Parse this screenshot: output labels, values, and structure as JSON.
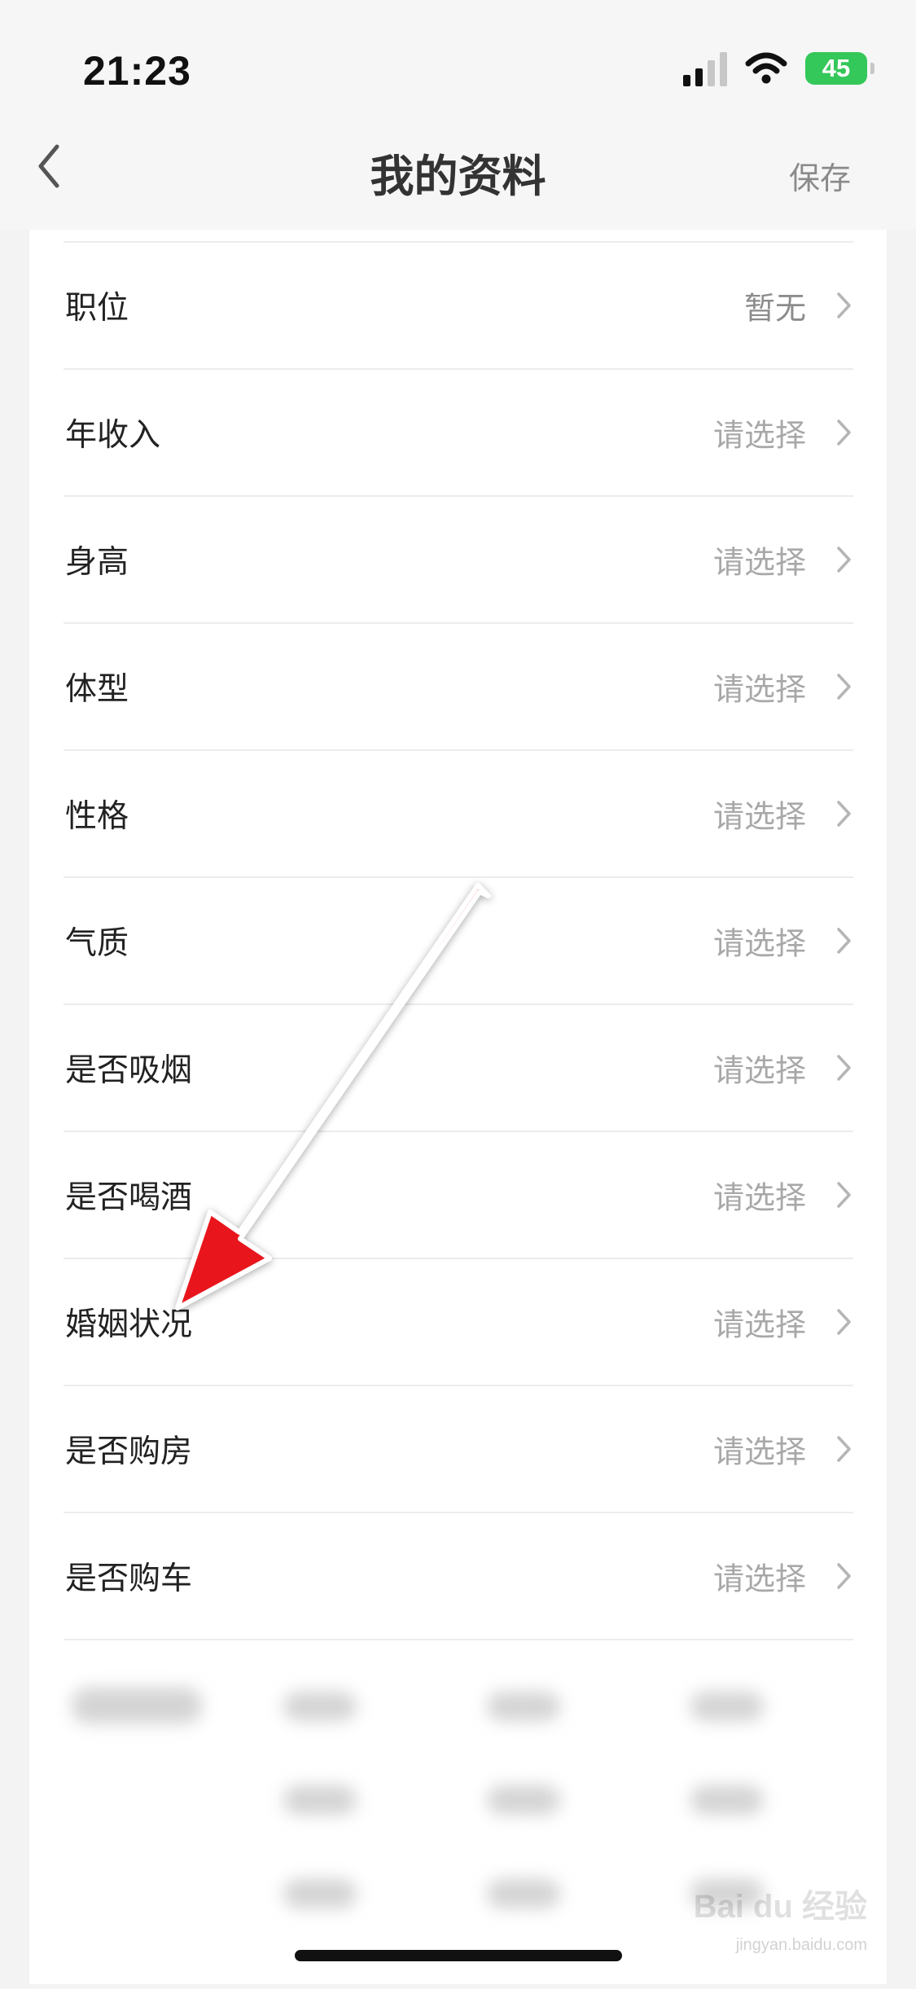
{
  "status_bar": {
    "time": "21:23",
    "battery": "45"
  },
  "nav": {
    "title": "我的资料",
    "save_label": "保存"
  },
  "profile_fields": [
    {
      "label": "职位",
      "value": "暂无",
      "filled": true
    },
    {
      "label": "年收入",
      "value": "请选择"
    },
    {
      "label": "身高",
      "value": "请选择"
    },
    {
      "label": "体型",
      "value": "请选择"
    },
    {
      "label": "性格",
      "value": "请选择"
    },
    {
      "label": "气质",
      "value": "请选择"
    },
    {
      "label": "是否吸烟",
      "value": "请选择"
    },
    {
      "label": "是否喝酒",
      "value": "请选择"
    },
    {
      "label": "婚姻状况",
      "value": "请选择"
    },
    {
      "label": "是否购房",
      "value": "请选择"
    },
    {
      "label": "是否购车",
      "value": "请选择"
    }
  ],
  "icons": {
    "back": "chevron-left-icon",
    "row": "chevron-right-icon",
    "signal": "cellular-signal-icon",
    "wifi": "wifi-icon",
    "battery": "battery-icon"
  },
  "colors": {
    "annotation_arrow": "#e8141b",
    "battery": "#34c759"
  },
  "watermark": {
    "brand": "Bai du 经验",
    "url": "jingyan.baidu.com"
  }
}
